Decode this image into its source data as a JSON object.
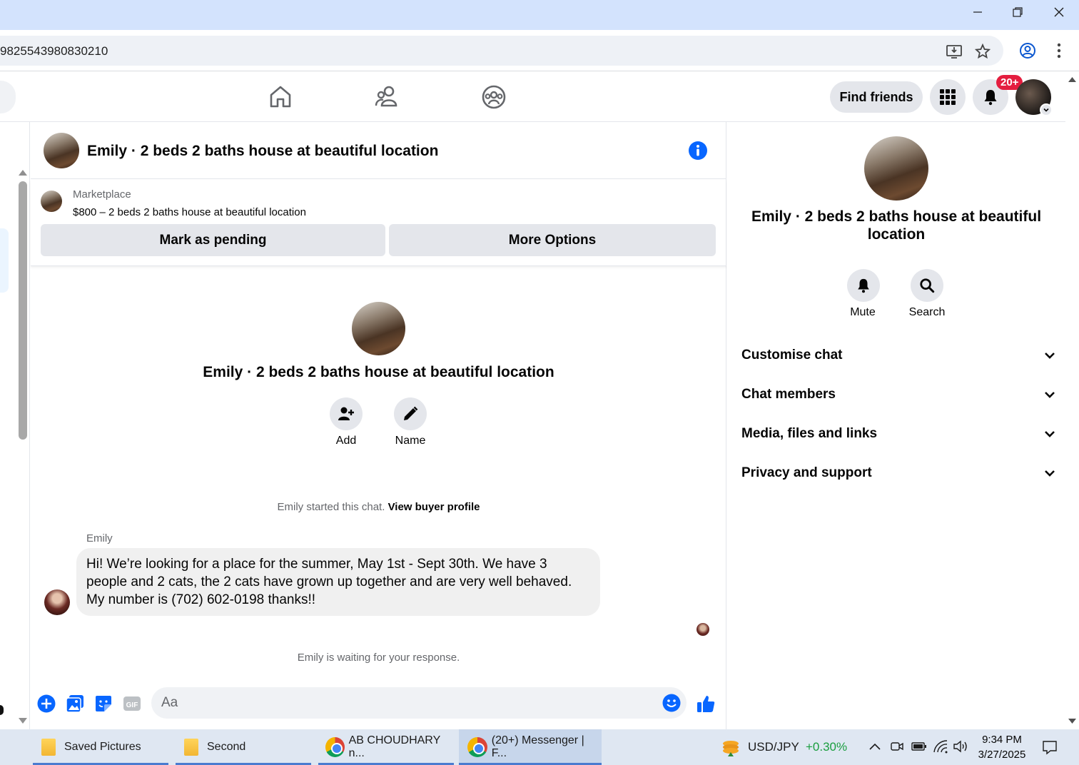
{
  "browser": {
    "url": "98255439808302​10",
    "icons": [
      "install-app-icon",
      "bookmark-star-icon",
      "profile-icon",
      "menu-dots-icon"
    ]
  },
  "window_controls": [
    "minimize-icon",
    "restore-icon",
    "close-icon"
  ],
  "fb_nav": {
    "tabs": [
      "home-icon",
      "friends-icon",
      "groups-icon"
    ],
    "find_friends": "Find friends",
    "notifications_badge": "20+"
  },
  "chat": {
    "header_title": "Emily · 2 beds 2 baths house at beautiful location",
    "marketplace": {
      "label": "Marketplace",
      "listing": "$800 – 2 beds 2 baths house at beautiful location",
      "pending_button": "Mark as pending",
      "more_button": "More Options"
    },
    "center_title": "Emily · 2 beds 2 baths house at beautiful location",
    "actions": [
      {
        "label": "Add",
        "icon": "add-person-icon"
      },
      {
        "label": "Name",
        "icon": "pencil-icon"
      }
    ],
    "started_text": "Emily started this chat.",
    "view_buyer": "View buyer profile",
    "sender": "Emily",
    "message": "Hi! We’re looking for a place for the summer, May 1st - Sept 30th. We have 3 people and 2 cats, the 2 cats have grown up together and are very well behaved. My number is (702) 602-0198 thanks!!",
    "waiting_text": "Emily is waiting for your response.",
    "composer_placeholder": "Aa",
    "composer_icons": [
      "plus-circle-icon",
      "image-icon",
      "sticker-icon",
      "gif-icon",
      "emoji-icon",
      "like-thumb-icon"
    ]
  },
  "right_panel": {
    "title": "Emily · 2 beds 2 baths house at beautiful location",
    "mute_label": "Mute",
    "search_label": "Search",
    "sections": [
      "Customise chat",
      "Chat members",
      "Media, files and links",
      "Privacy and support"
    ]
  },
  "taskbar": {
    "items": [
      {
        "label": "Saved Pictures",
        "icon": "folder-icon"
      },
      {
        "label": "Second",
        "icon": "folder-icon"
      },
      {
        "label": "AB CHOUDHARY n...",
        "icon": "chrome-icon"
      },
      {
        "label": "(20+) Messenger | F...",
        "icon": "chrome-icon"
      }
    ],
    "ticker_label": "USD/JPY",
    "ticker_change": "+0.30%",
    "time": "9:34 PM",
    "date": "3/27/2025",
    "colors": {
      "ticker_positive": "#1a9e3f",
      "accent": "#0866ff",
      "badge": "#e41e3f"
    }
  }
}
